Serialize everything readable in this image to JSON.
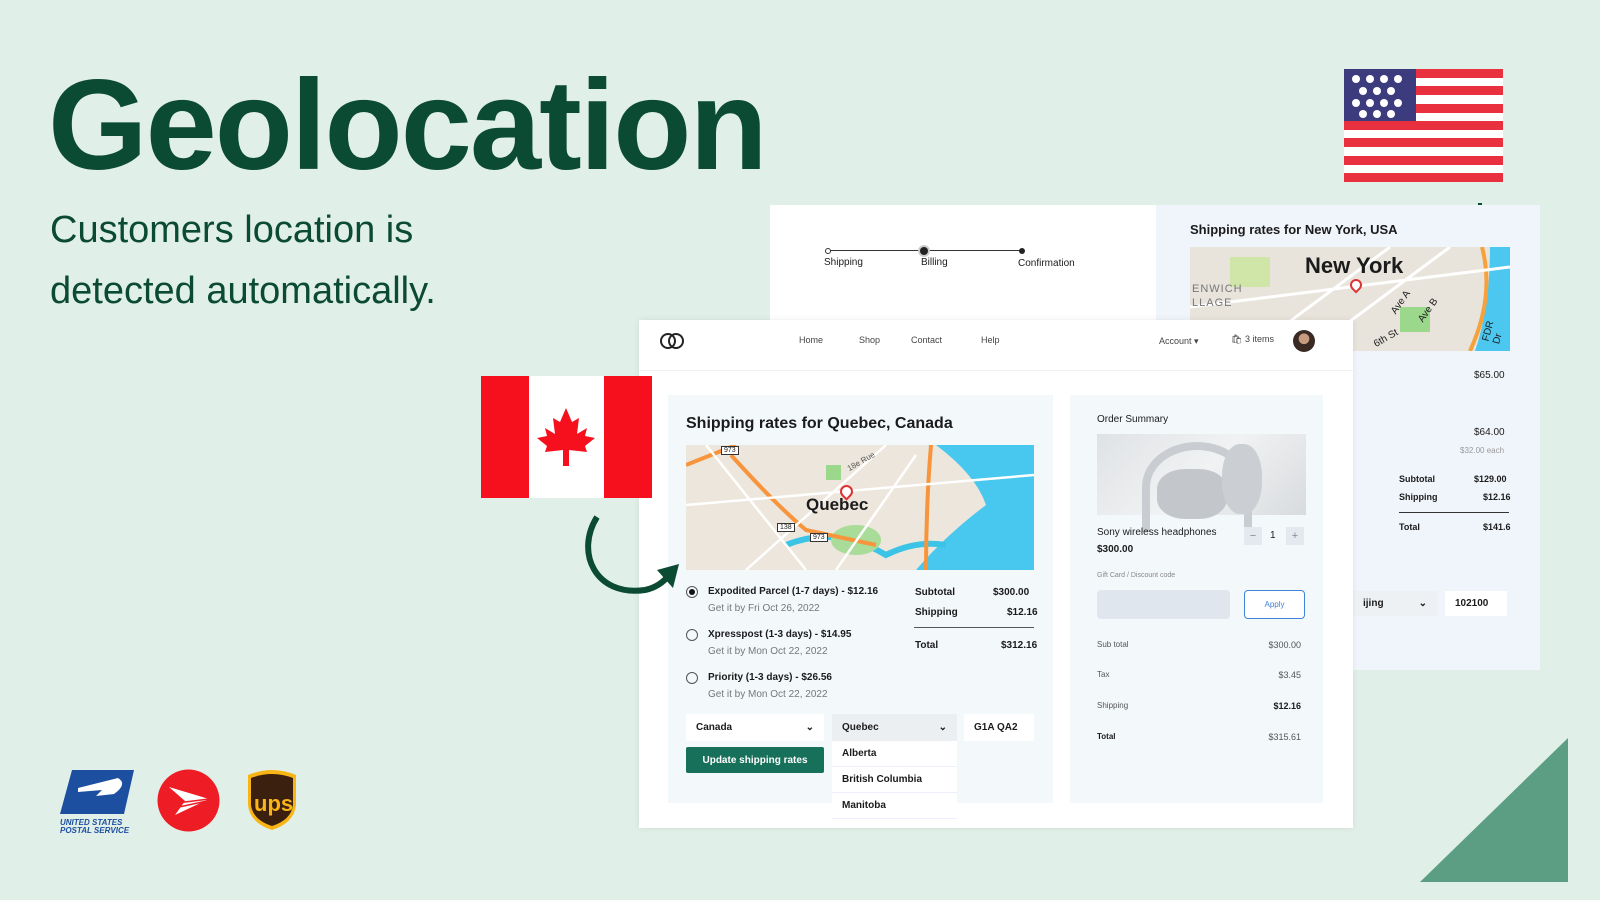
{
  "hero": {
    "title": "Geolocation",
    "subtitle_line1": "Customers location is",
    "subtitle_line2": "detected automatically."
  },
  "back_checkout": {
    "steps": [
      "Shipping",
      "Billing",
      "Confirmation"
    ],
    "rates_title": "Shipping rates for New York, USA",
    "map_label": "New York",
    "map_streets": [
      "ENWICH",
      "LLAGE",
      "Ave A",
      "Ave B",
      "6th St",
      "FDR Dr"
    ],
    "price1": "$65.00",
    "price2": "$64.00",
    "each": "$32.00 each",
    "subtotal_label": "Subtotal",
    "subtotal": "$129.00",
    "shipping_label": "Shipping",
    "shipping": "$12.16",
    "total_label": "Total",
    "total": "$141.6",
    "city_select": "ijing",
    "postal": "102100"
  },
  "nav": {
    "links": [
      "Home",
      "Shop",
      "Contact",
      "Help"
    ],
    "account": "Account",
    "cart": "3 items"
  },
  "shipping": {
    "title": "Shipping rates for Quebec, Canada",
    "map_label": "Quebec",
    "map_shields": [
      "973",
      "138",
      "973"
    ],
    "map_street": "18e Rue",
    "options": [
      {
        "label": "Expodited Parcel (1-7 days) - $12.16",
        "eta": "Get it by Fri Oct 26, 2022",
        "selected": true
      },
      {
        "label": "Xpresspost (1-3 days) - $14.95",
        "eta": "Get it by Mon Oct 22, 2022",
        "selected": false
      },
      {
        "label": "Priority (1-3 days) - $26.56",
        "eta": "Get it by Mon Oct 22, 2022",
        "selected": false
      }
    ],
    "subtotal_label": "Subtotal",
    "subtotal": "$300.00",
    "shipping_label": "Shipping",
    "shipping": "$12.16",
    "total_label": "Total",
    "total": "$312.16",
    "country": "Canada",
    "province": "Quebec",
    "postal": "G1A QA2",
    "province_options": [
      "Alberta",
      "British Columbia",
      "Manitoba"
    ],
    "update_button": "Update shipping rates"
  },
  "order": {
    "title": "Order Summary",
    "product": "Sony wireless headphones",
    "price": "$300.00",
    "qty": "1",
    "discount_label": "Gift Card / Discount code",
    "discount_value": "",
    "apply": "Apply",
    "rows": [
      {
        "label": "Sub total",
        "value": "$300.00"
      },
      {
        "label": "Tax",
        "value": "$3.45"
      },
      {
        "label": "Shipping",
        "value": "$12.16"
      },
      {
        "label": "Total",
        "value": "$315.61"
      }
    ]
  },
  "carriers": {
    "usps": "UNITED STATES POSTAL SERVICE",
    "ups": "ups"
  },
  "colors": {
    "brand": "#0b4a33",
    "button": "#17705a",
    "background": "#e1efe9"
  }
}
